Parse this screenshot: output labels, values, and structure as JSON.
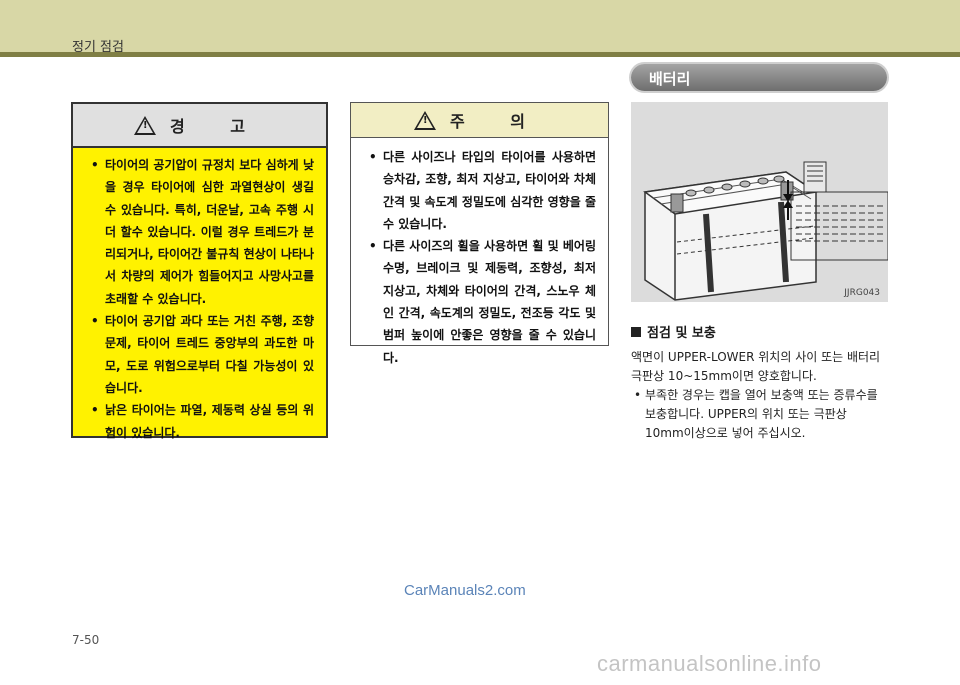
{
  "header": {
    "section_title": "정기 점검"
  },
  "warning": {
    "title": "경 고",
    "items": [
      "타이어의 공기압이 규정치 보다 심하게 낮을 경우 타이어에 심한 과열현상이 생길 수 있습니다. 특히, 더운날, 고속 주행 시 더 할수 있습니다. 이럴 경우 트레드가 분리되거나, 타이어간 불규칙 현상이 나타나서 차량의 제어가 힘들어지고 사망사고를 초래할 수 있습니다.",
      "타이어 공기압 과다 또는 거친 주행, 조향 문제, 타이어 트레드 중앙부의 과도한 마모, 도로 위험으로부터 다칠 가능성이 있습니다.",
      "낡은 타이어는 파열, 제동력 상실 등의 위험이 있습니다."
    ]
  },
  "caution": {
    "title": "주 의",
    "items": [
      "다른 사이즈나 타입의 타이어를 사용하면 승차감, 조향, 최저 지상고, 타이어와 차체 간격 및 속도계 정밀도에 심각한 영향을 줄 수 있습니다.",
      "다른 사이즈의 휠을 사용하면 휠 및 베어링 수명, 브레이크 및 제동력, 조향성, 최저 지상고, 차체와 타이어의 간격, 스노우 체인 간격, 속도계의 정밀도, 전조등 각도 및 범퍼 높이에 안좋은 영향을 줄 수 있습니다."
    ]
  },
  "battery": {
    "pill_title": "배터리",
    "figure_code": "JJRG043",
    "subheading": "점검 및 보충",
    "paragraph": "액면이 UPPER-LOWER 위치의 사이 또는 배터리 극판상 10~15mm이면 양호합니다.",
    "bullets": [
      "부족한 경우는 캡을 열어 보충액 또는 증류수를 보충합니다. UPPER의 위치 또는 극판상 10mm이상으로 넣어 주십시오."
    ]
  },
  "watermark": "CarManuals2.com",
  "page_number": "7-50",
  "footer_watermark": "carmanualsonline.info",
  "colors": {
    "header_band": "#d8d7a6",
    "header_line": "#807f45",
    "warning_bg": "#fff200",
    "caution_head": "#f2eec4",
    "pill": "#8a8a8a"
  }
}
